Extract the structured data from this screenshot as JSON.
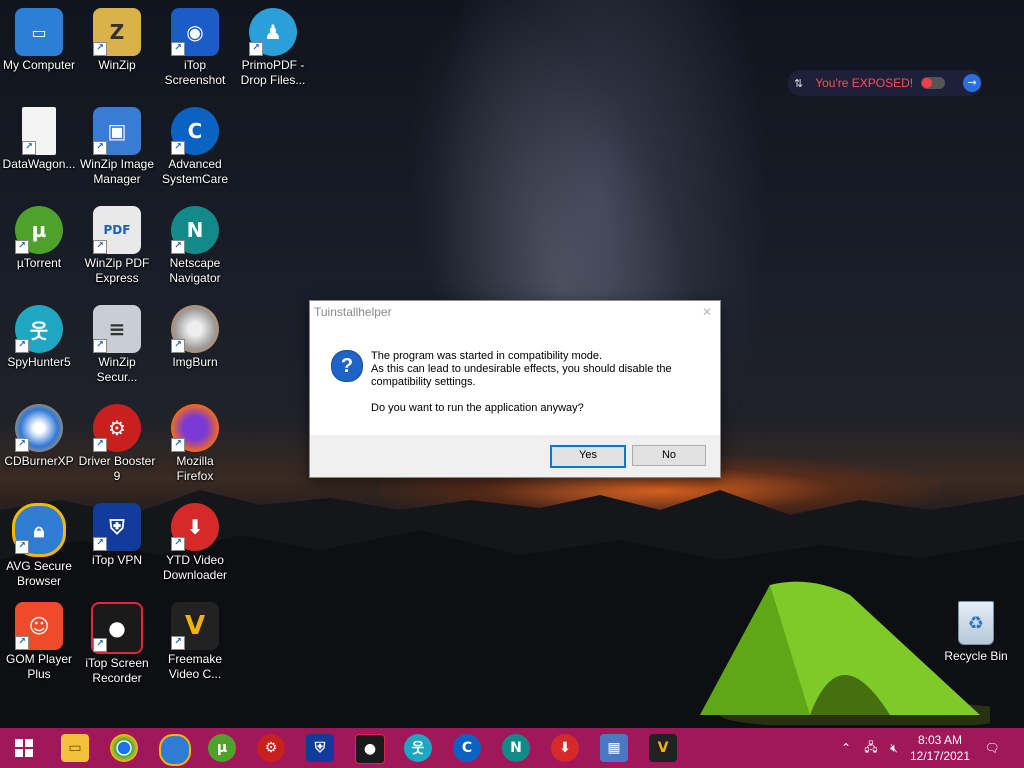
{
  "desktop_icons": [
    {
      "label": "My Computer"
    },
    {
      "label": "WinZip"
    },
    {
      "label": "iTop\nScreenshot"
    },
    {
      "label": "PrimoPDF -\nDrop Files..."
    },
    {
      "label": "DataWagon..."
    },
    {
      "label": "WinZip Image\nManager"
    },
    {
      "label": "Advanced\nSystemCare"
    },
    {
      "label": "µTorrent"
    },
    {
      "label": "WinZip PDF\nExpress"
    },
    {
      "label": "Netscape\nNavigator"
    },
    {
      "label": "SpyHunter5"
    },
    {
      "label": "WinZip\nSecur..."
    },
    {
      "label": "ImgBurn"
    },
    {
      "label": "CDBurnerXP"
    },
    {
      "label": "Driver Booster\n9"
    },
    {
      "label": "Mozilla\nFirefox"
    },
    {
      "label": "AVG Secure\nBrowser"
    },
    {
      "label": "iTop VPN"
    },
    {
      "label": "YTD Video\nDownloader"
    },
    {
      "label": "GOM Player\nPlus"
    },
    {
      "label": "iTop Screen\nRecorder"
    },
    {
      "label": "Freemake\nVideo C..."
    }
  ],
  "exposed_widget": {
    "text": "You're EXPOSED!"
  },
  "dialog": {
    "title": "Tuinstallhelper",
    "line1": "The program was started in compatibility mode.",
    "line2": "As this can lead to undesirable effects, you should disable the compatibility settings.",
    "question": "Do you want to run the application anyway?",
    "yes_label": "Yes",
    "no_label": "No"
  },
  "recycle_bin": {
    "label": "Recycle Bin"
  },
  "taskbar": {
    "time": "8:03 AM",
    "date": "12/17/2021"
  },
  "colors": {
    "taskbar": "#a0185a",
    "dialog_accent": "#0078d7"
  }
}
